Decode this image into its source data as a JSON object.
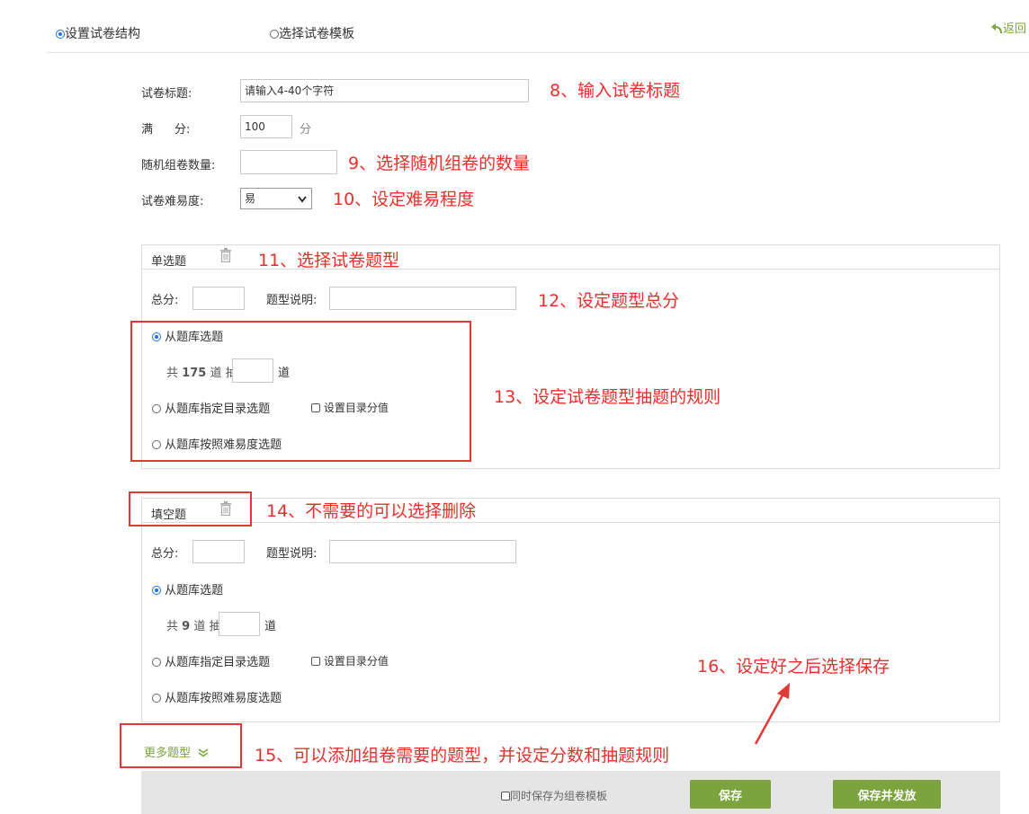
{
  "top": {
    "mode_structure": "设置试卷结构",
    "mode_template": "选择试卷模板",
    "back": "返回"
  },
  "form": {
    "title_label": "试卷标题:",
    "title_value": "请输入4-40个字符",
    "score_label_a": "满",
    "score_label_b": "分:",
    "score_value": "100",
    "score_unit": "分",
    "random_label": "随机组卷数量:",
    "random_value": "",
    "difficulty_label": "试卷难易度:",
    "difficulty_value": "易"
  },
  "sections": [
    {
      "name": "单选题",
      "total_label": "总分:",
      "desc_label": "题型说明:",
      "opt_bank": "从题库选题",
      "count_prefix": "共",
      "count": "175",
      "count_mid": "道 抽",
      "count_suffix": "道",
      "opt_dir": "从题库指定目录选题",
      "dir_score": "设置目录分值",
      "opt_diff": "从题库按照难易度选题"
    },
    {
      "name": "填空题",
      "total_label": "总分:",
      "desc_label": "题型说明:",
      "opt_bank": "从题库选题",
      "count_prefix": "共",
      "count": "9",
      "count_mid": "道 抽",
      "count_suffix": "道",
      "opt_dir": "从题库指定目录选题",
      "dir_score": "设置目录分值",
      "opt_diff": "从题库按照难易度选题"
    }
  ],
  "more_types": "更多题型",
  "footer": {
    "save_template": "同时保存为组卷模板",
    "save": "保存",
    "save_publish": "保存并发放"
  },
  "annotations": {
    "a8": "8、输入试卷标题",
    "a9": "9、选择随机组卷的数量",
    "a10": "10、设定难易程度",
    "a11": "11、选择试卷题型",
    "a12": "12、设定题型总分",
    "a13": "13、设定试卷题型抽题的规则",
    "a14": "14、不需要的可以选择删除",
    "a15": "15、可以添加组卷需要的题型，并设定分数和抽题规则",
    "a16": "16、设定好之后选择保存"
  },
  "colors": {
    "accent_green": "#7ba33e",
    "annotation_red": "#e8302c",
    "radio_blue": "#1a73e8"
  }
}
